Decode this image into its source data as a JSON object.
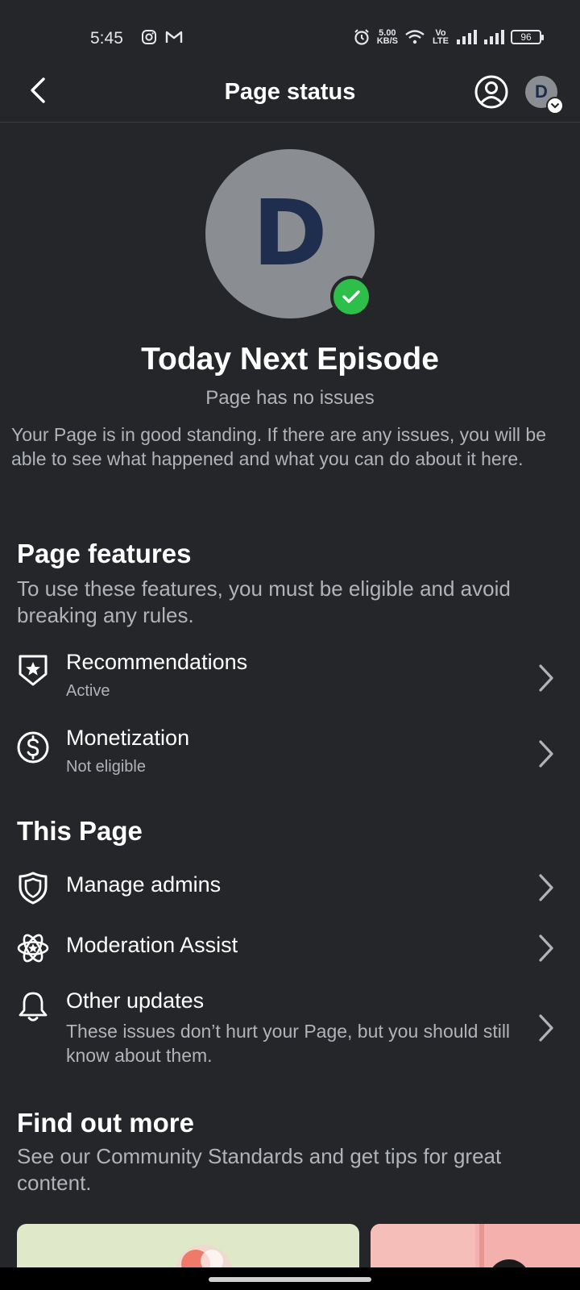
{
  "status_bar": {
    "time": "5:45",
    "speed_top": "5.00",
    "speed_bottom": "KB/S",
    "volte": "Vo LTE",
    "battery": "96"
  },
  "header": {
    "title": "Page status",
    "account_initial": "D"
  },
  "profile": {
    "avatar_initial": "D",
    "name": "Today Next Episode",
    "status": "Page has no issues",
    "description": "Your Page is in good standing. If there are any issues, you will be able to see what happened and what you can do about it here."
  },
  "features": {
    "title": "Page features",
    "subtitle": "To use these features, you must be eligible and avoid breaking any rules.",
    "items": [
      {
        "label": "Recommendations",
        "status": "Active",
        "icon": "star-badge-icon"
      },
      {
        "label": "Monetization",
        "status": "Not eligible",
        "icon": "dollar-circle-icon"
      }
    ]
  },
  "this_page": {
    "title": "This Page",
    "items": [
      {
        "label": "Manage admins",
        "icon": "shield-icon"
      },
      {
        "label": "Moderation Assist",
        "icon": "atom-icon"
      },
      {
        "label": "Other updates",
        "description": "These issues don’t hurt your Page, but you should still know about them.",
        "icon": "bell-icon"
      }
    ]
  },
  "find_out_more": {
    "title": "Find out more",
    "subtitle": "See our Community Standards and get tips for great content."
  },
  "colors": {
    "background": "#252629",
    "verified_green": "#2ebe4a",
    "text_primary": "#ffffff",
    "text_secondary": "#b0b3b8"
  }
}
